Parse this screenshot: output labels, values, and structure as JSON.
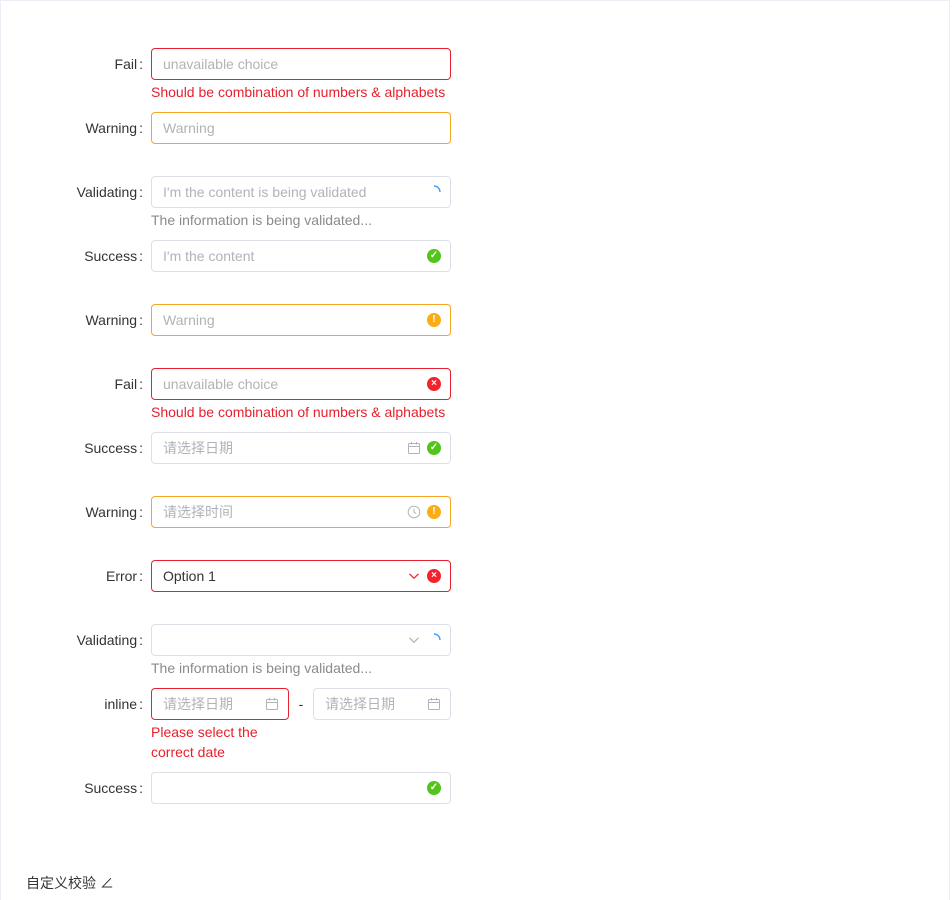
{
  "rows": [
    {
      "label": "Fail",
      "placeholder": "unavailable choice",
      "message": "Should be combination of numbers & alphabets"
    },
    {
      "label": "Warning",
      "placeholder": "Warning"
    },
    {
      "label": "Validating",
      "placeholder": "I'm the content is being validated",
      "message": "The information is being validated..."
    },
    {
      "label": "Success",
      "placeholder": "I'm the content"
    },
    {
      "label": "Warning",
      "placeholder": "Warning"
    },
    {
      "label": "Fail",
      "placeholder": "unavailable choice",
      "message": "Should be combination of numbers & alphabets"
    },
    {
      "label": "Success",
      "placeholder": "请选择日期"
    },
    {
      "label": "Warning",
      "placeholder": "请选择时间"
    },
    {
      "label": "Error",
      "value": "Option 1"
    },
    {
      "label": "Validating",
      "value": "",
      "message": "The information is being validated..."
    },
    {
      "label": "inline",
      "start_placeholder": "请选择日期",
      "end_placeholder": "请选择日期",
      "separator": "-",
      "message": "Please select the correct date"
    },
    {
      "label": "Success",
      "value": ""
    }
  ],
  "colon": ":",
  "footer_text": "自定义校验 ∠",
  "colors": {
    "error": "#e7202e",
    "warning": "#f5a623",
    "success": "#52c41a",
    "validating": "#409eff"
  }
}
